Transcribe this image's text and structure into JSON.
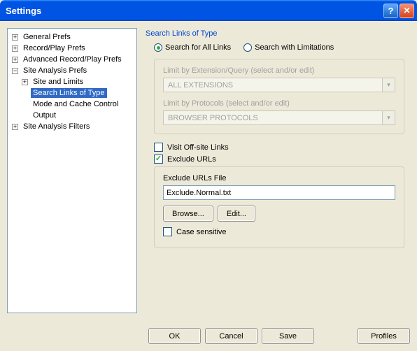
{
  "window": {
    "title": "Settings"
  },
  "tree": {
    "items": [
      {
        "label": "General Prefs",
        "exp": "+"
      },
      {
        "label": "Record/Play Prefs",
        "exp": "+"
      },
      {
        "label": "Advanced Record/Play Prefs",
        "exp": "+"
      },
      {
        "label": "Site Analysis Prefs",
        "exp": "−",
        "children": [
          {
            "label": "Site and Limits",
            "exp": "+"
          },
          {
            "label": "Search Links of Type",
            "selected": true
          },
          {
            "label": "Mode and Cache Control"
          },
          {
            "label": "Output"
          }
        ]
      },
      {
        "label": "Site Analysis Filters",
        "exp": "+"
      }
    ]
  },
  "panel": {
    "title": "Search Links of Type",
    "radio_all": "Search for All Links",
    "radio_lim": "Search with Limitations",
    "ext_label": "Limit by Extension/Query (select and/or edit)",
    "ext_value": "ALL EXTENSIONS",
    "proto_label": "Limit by Protocols (select and/or edit)",
    "proto_value": "BROWSER PROTOCOLS",
    "visit_label": "Visit Off-site Links",
    "exclude_label": "Exclude URLs",
    "exclude_file_label": "Exclude URLs File",
    "exclude_file_value": "Exclude.Normal.txt",
    "browse": "Browse...",
    "edit": "Edit...",
    "case_label": "Case sensitive"
  },
  "footer": {
    "ok": "OK",
    "cancel": "Cancel",
    "save": "Save",
    "profiles": "Profiles"
  }
}
